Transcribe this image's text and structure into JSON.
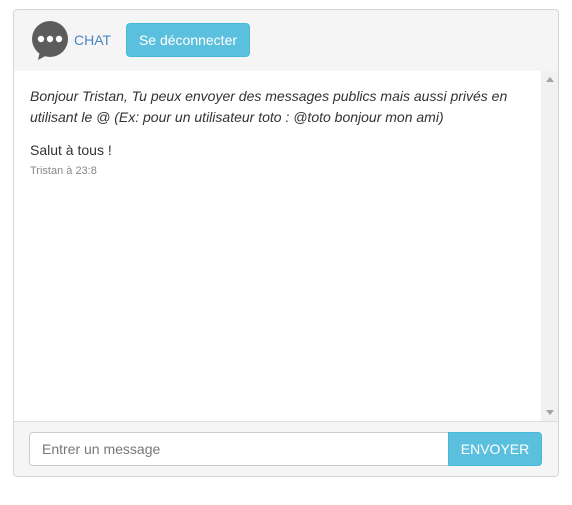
{
  "header": {
    "logo_icon": "chat-bubble-icon",
    "brand": "CHAT",
    "logout_label": "Se déconnecter"
  },
  "messages": {
    "welcome": "Bonjour Tristan, Tu peux envoyer des messages publics mais aussi privés en utilisant le @ (Ex: pour un utilisateur toto : @toto bonjour mon ami)",
    "items": [
      {
        "text": "Salut à tous !",
        "meta": "Tristan à 23:8"
      }
    ]
  },
  "composer": {
    "placeholder": "Entrer un message",
    "value": "",
    "send_label": "ENVOYER"
  },
  "colors": {
    "accent": "#5bc0de",
    "brand": "#4a87c0",
    "icon": "#5c5c5c"
  }
}
